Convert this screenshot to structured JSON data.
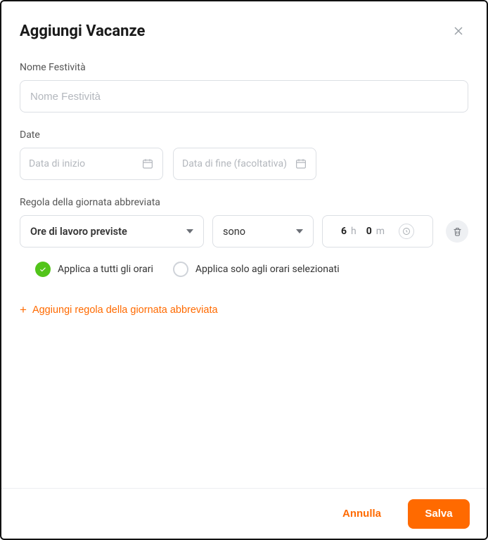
{
  "modal": {
    "title": "Aggiungi Vacanze"
  },
  "holiday_name": {
    "label": "Nome Festività",
    "placeholder": "Nome Festività",
    "value": ""
  },
  "dates": {
    "label": "Date",
    "start": {
      "placeholder": "Data di inizio",
      "value": ""
    },
    "end": {
      "placeholder": "Data di fine (facoltativa)",
      "value": ""
    }
  },
  "shortened_rule": {
    "label": "Regola della giornata abbreviata",
    "type_select": {
      "value": "Ore di lavoro previste"
    },
    "condition_select": {
      "value": "sono"
    },
    "time": {
      "hours": "6",
      "hours_unit": "h",
      "minutes": "0",
      "minutes_unit": "m"
    }
  },
  "apply_options": {
    "all": {
      "label": "Applica a tutti gli orari",
      "selected": true
    },
    "selected": {
      "label": "Applica solo agli orari selezionati",
      "selected": false
    }
  },
  "add_rule_button": "Aggiungi regola della giornata abbreviata",
  "footer": {
    "cancel": "Annulla",
    "save": "Salva"
  }
}
